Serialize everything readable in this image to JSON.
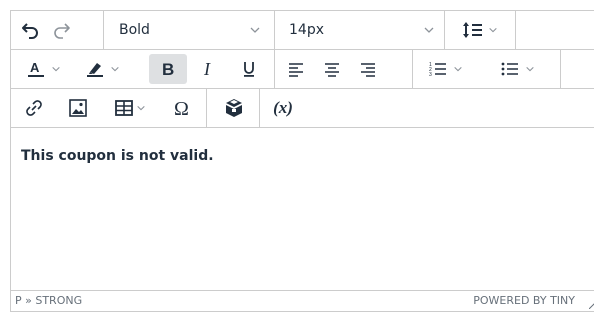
{
  "toolbar": {
    "row1": {
      "undo_icon": "undo-icon",
      "redo_icon": "redo-icon",
      "font_weight_value": "Bold",
      "font_size_value": "14px",
      "line_height_icon": "line-height-icon"
    },
    "row2": {
      "text_color_icon": "text-color-icon",
      "highlight_icon": "highlight-icon",
      "bold_icon": "bold-icon",
      "italic_icon": "italic-icon",
      "underline_icon": "underline-icon",
      "align_left_icon": "align-left-icon",
      "align_center_icon": "align-center-icon",
      "align_right_icon": "align-right-icon",
      "numbered_list_icon": "numbered-list-icon",
      "bullet_list_icon": "bullet-list-icon"
    },
    "row3": {
      "link_icon": "link-icon",
      "image_icon": "image-icon",
      "table_icon": "table-icon",
      "special_char_icon": "omega-icon",
      "template_icon": "template-icon",
      "variable_label": "(x)"
    }
  },
  "content": {
    "text": "This coupon is not valid."
  },
  "statusbar": {
    "path": "P » STRONG",
    "brand": "POWERED BY TINY"
  },
  "colors": {
    "border": "#cccccc",
    "active_bg": "#dee0e2",
    "text": "#222f3e",
    "muted": "#67707a",
    "text_color_bar": "#222f3e"
  }
}
